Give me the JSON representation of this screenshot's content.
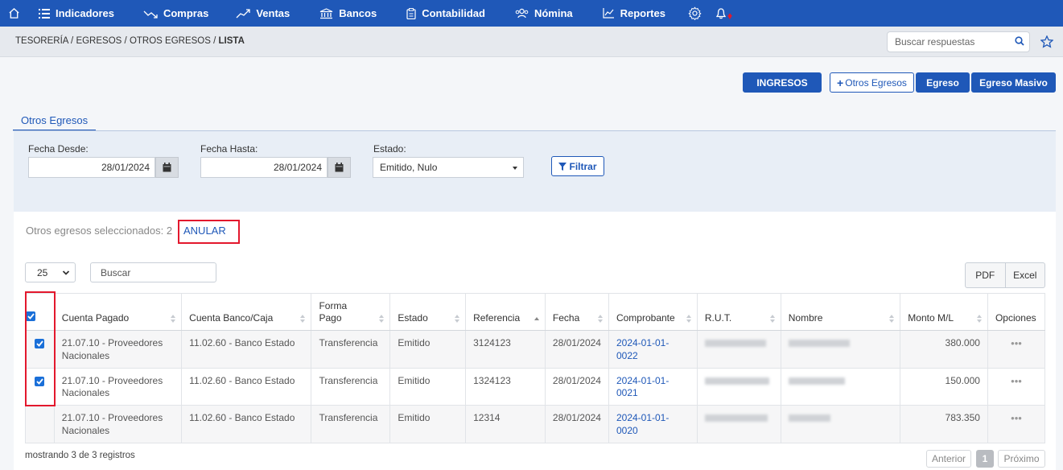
{
  "nav": {
    "items": [
      {
        "label": "Indicadores",
        "icon": "list-icon"
      },
      {
        "label": "Compras",
        "icon": "trend-down-icon"
      },
      {
        "label": "Ventas",
        "icon": "trend-up-icon"
      },
      {
        "label": "Bancos",
        "icon": "bank-icon"
      },
      {
        "label": "Contabilidad",
        "icon": "clipboard-icon"
      },
      {
        "label": "Nómina",
        "icon": "users-icon"
      },
      {
        "label": "Reportes",
        "icon": "chart-icon"
      }
    ]
  },
  "breadcrumb": {
    "items": [
      "TESORERÍA",
      "EGRESOS",
      "OTROS EGRESOS"
    ],
    "current": "LISTA",
    "separator": "/"
  },
  "help_search": {
    "placeholder": "Buscar respuestas"
  },
  "actions": {
    "ingresos": "INGRESOS",
    "otros_egresos": "Otros Egresos",
    "egreso": "Egreso",
    "egreso_masivo": "Egreso Masivo"
  },
  "tab": {
    "label": "Otros Egresos"
  },
  "filters": {
    "fecha_desde": {
      "label": "Fecha Desde:",
      "value": "28/01/2024"
    },
    "fecha_hasta": {
      "label": "Fecha Hasta:",
      "value": "28/01/2024"
    },
    "estado": {
      "label": "Estado:",
      "value": "Emitido, Nulo"
    },
    "filtrar": "Filtrar"
  },
  "selection": {
    "text": "Otros egresos seleccionados: 2",
    "anular": "ANULAR"
  },
  "table_controls": {
    "page_length": "25",
    "search_placeholder": "Buscar",
    "pdf": "PDF",
    "excel": "Excel"
  },
  "table": {
    "headers": [
      "Cuenta Pagado",
      "Cuenta Banco/Caja",
      "Forma Pago",
      "Estado",
      "Referencia",
      "Fecha",
      "Comprobante",
      "R.U.T.",
      "Nombre",
      "Monto M/L",
      "Opciones"
    ],
    "rows": [
      {
        "checked": true,
        "cuenta_pagado": "21.07.10 - Proveedores Nacionales",
        "cuenta_banco": "11.02.60 - Banco Estado",
        "forma_pago": "Transferencia",
        "estado": "Emitido",
        "referencia": "3124123",
        "fecha": "28/01/2024",
        "comprobante": "2024-01-01-0022",
        "monto": "380.000",
        "opciones": "•••"
      },
      {
        "checked": true,
        "cuenta_pagado": "21.07.10 - Proveedores Nacionales",
        "cuenta_banco": "11.02.60 - Banco Estado",
        "forma_pago": "Transferencia",
        "estado": "Emitido",
        "referencia": "1324123",
        "fecha": "28/01/2024",
        "comprobante": "2024-01-01-0021",
        "monto": "150.000",
        "opciones": "•••"
      },
      {
        "checked": false,
        "cuenta_pagado": "21.07.10 - Proveedores Nacionales",
        "cuenta_banco": "11.02.60 - Banco Estado",
        "forma_pago": "Transferencia",
        "estado": "Emitido",
        "referencia": "12314",
        "fecha": "28/01/2024",
        "comprobante": "2024-01-01-0020",
        "monto": "783.350",
        "opciones": "•••"
      }
    ]
  },
  "footer": {
    "info": "mostrando 3 de 3 registros",
    "prev": "Anterior",
    "page": "1",
    "next": "Próximo"
  },
  "colors": {
    "primary": "#1f58b8",
    "highlight": "#e3182d",
    "checkbox": "#1a6fd8"
  }
}
